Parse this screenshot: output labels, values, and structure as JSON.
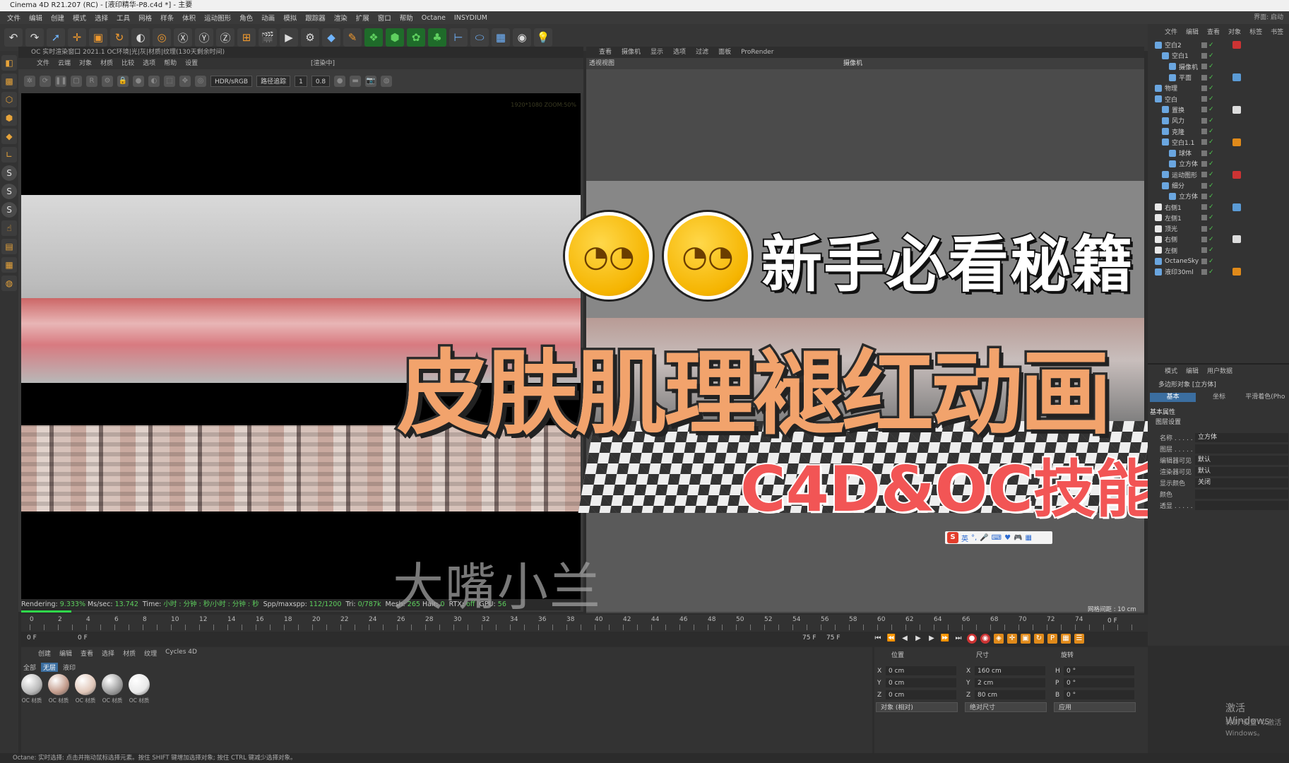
{
  "window": {
    "title": "Cinema 4D R21.207 (RC) - [液印精华-P8.c4d *] - 主要"
  },
  "menu": [
    "文件",
    "编辑",
    "创建",
    "模式",
    "选择",
    "工具",
    "网格",
    "样条",
    "体积",
    "运动图形",
    "角色",
    "动画",
    "模拟",
    "跟踪器",
    "渲染",
    "扩展",
    "窗口",
    "帮助",
    "Octane",
    "INSYDIUM"
  ],
  "menu_right": "界面: 启动",
  "render_viewer": {
    "title": "OC 实时渲染窗口 2021.1  OC环境|光|灰|材质|纹理(130天剩余时间)",
    "menu": [
      "文件",
      "云端",
      "对象",
      "材质",
      "比较",
      "选项",
      "帮助",
      "设置"
    ],
    "menu_extra": "[渲染中]",
    "color_mode": "HDR/sRGB",
    "mode_select": "路径追踪",
    "val1": "1",
    "val2": "0.8",
    "resolution": "1920*1080 ZOOM:50%",
    "stats": {
      "rendering_label": "Rendering:",
      "rendering_pct": "9.333%",
      "mssec_label": "Ms/sec:",
      "mssec": "13.742",
      "time_label": "Time:",
      "time": "小时 : 分钟 : 秒/小时 : 分钟 : 秒",
      "spp_label": "Spp/maxspp:",
      "spp": "112/1200",
      "tri_label": "Tri:",
      "tri": "0/787k",
      "mesh_label": "Mesh:",
      "mesh": "265",
      "hair_label": "Hair:",
      "hair": "0",
      "rtx_label": "RTX:",
      "rtx": "off",
      "gpu_label": "GPU:",
      "gpu": "56"
    },
    "progress": 0.09
  },
  "viewport": {
    "tabs": [
      "查看",
      "摄像机",
      "显示",
      "选项",
      "过滤",
      "面板",
      "ProRender"
    ],
    "label": "透视视图",
    "camera": "摄像机",
    "grid": "网格间距 : 10 cm"
  },
  "overlay": {
    "headline1": "新手必看秘籍",
    "headline2": "皮肤肌理褪红动画",
    "headline3": "C4D&OC技能",
    "watermark": "大嘴小兰"
  },
  "ime": {
    "label": "英"
  },
  "object_manager": {
    "tabs": [
      "文件",
      "编辑",
      "查看",
      "对象",
      "标签",
      "书签"
    ],
    "items": [
      {
        "name": "空白2",
        "indent": 0
      },
      {
        "name": "空白1",
        "indent": 1
      },
      {
        "name": "摄像机",
        "indent": 2
      },
      {
        "name": "平面",
        "indent": 2
      },
      {
        "name": "物理",
        "indent": 0
      },
      {
        "name": "空白",
        "indent": 0
      },
      {
        "name": "置换",
        "indent": 1
      },
      {
        "name": "风力",
        "indent": 1
      },
      {
        "name": "克隆",
        "indent": 1
      },
      {
        "name": "空白1.1",
        "indent": 1
      },
      {
        "name": "球体",
        "indent": 2
      },
      {
        "name": "立方体",
        "indent": 2
      },
      {
        "name": "运动图形",
        "indent": 1
      },
      {
        "name": "细分",
        "indent": 1
      },
      {
        "name": "立方体",
        "indent": 2
      },
      {
        "name": "右侧1",
        "indent": 0
      },
      {
        "name": "左侧1",
        "indent": 0
      },
      {
        "name": "顶光",
        "indent": 0
      },
      {
        "name": "右侧",
        "indent": 0
      },
      {
        "name": "左侧",
        "indent": 0
      },
      {
        "name": "OctaneSky",
        "indent": 0
      },
      {
        "name": "液印30ml",
        "indent": 0
      }
    ]
  },
  "attributes": {
    "tabs": [
      "模式",
      "编辑",
      "用户数据"
    ],
    "mode": "多边形对象 [立方体]",
    "subtabs": [
      "基本",
      "坐标",
      "平滑着色(Pho"
    ],
    "section": "基本属性",
    "subsection": "图层设置",
    "fields": [
      {
        "label": "名称 . . . . .",
        "value": "立方体"
      },
      {
        "label": "图层 . . . . .",
        "value": ""
      },
      {
        "label": "编辑器可见",
        "value": "默认"
      },
      {
        "label": "渲染器可见",
        "value": "默认"
      },
      {
        "label": "显示颜色",
        "value": "关闭"
      },
      {
        "label": "颜色",
        "value": ""
      },
      {
        "label": "透显 . . . . .",
        "value": ""
      }
    ]
  },
  "timeline": {
    "ticks": [
      "0",
      "2",
      "4",
      "6",
      "8",
      "10",
      "12",
      "14",
      "16",
      "18",
      "20",
      "22",
      "24",
      "26",
      "28",
      "30",
      "32",
      "34",
      "36",
      "38",
      "40",
      "42",
      "44",
      "46",
      "48",
      "50",
      "52",
      "54",
      "56",
      "58",
      "60",
      "62",
      "64",
      "66",
      "68",
      "70",
      "72",
      "74"
    ],
    "current": "0 F",
    "start": "0 F",
    "min": "0 F",
    "end": "75 F",
    "max": "75 F"
  },
  "material_manager": {
    "tabs": [
      "创建",
      "编辑",
      "查看",
      "选择",
      "材质",
      "纹理",
      "Cycles 4D"
    ],
    "subtabs": [
      "全部",
      "无层",
      "液印"
    ],
    "materials": [
      {
        "name": "OC 材质",
        "color": "#b9b9b9"
      },
      {
        "name": "OC 材质",
        "color": "#c29a8a"
      },
      {
        "name": "OC 材质",
        "color": "#e0c6b8"
      },
      {
        "name": "OC 材质",
        "color": "#9c9c9c"
      },
      {
        "name": "OC 材质",
        "color": "#e8e8e8"
      }
    ]
  },
  "coordinates": {
    "headers": [
      "位置",
      "尺寸",
      "旋转"
    ],
    "rows": [
      {
        "a": "X",
        "pos": "0 cm",
        "b": "X",
        "size": "160 cm",
        "c": "H",
        "rot": "0 °"
      },
      {
        "a": "Y",
        "pos": "0 cm",
        "b": "Y",
        "size": "2 cm",
        "c": "P",
        "rot": "0 °"
      },
      {
        "a": "Z",
        "pos": "0 cm",
        "b": "Z",
        "size": "80 cm",
        "c": "B",
        "rot": "0 °"
      }
    ],
    "mode": "对象 (相对)",
    "size_mode": "绝对尺寸",
    "apply": "应用"
  },
  "windows_activation": {
    "line1": "激活 Windows",
    "line2": "转到\"设置\"以激活 Windows。"
  },
  "status": "Octane:   实时选择: 点击并拖动鼠标选择元素。按住 SHIFT 键增加选择对象; 按住 CTRL 键减少选择对象。"
}
